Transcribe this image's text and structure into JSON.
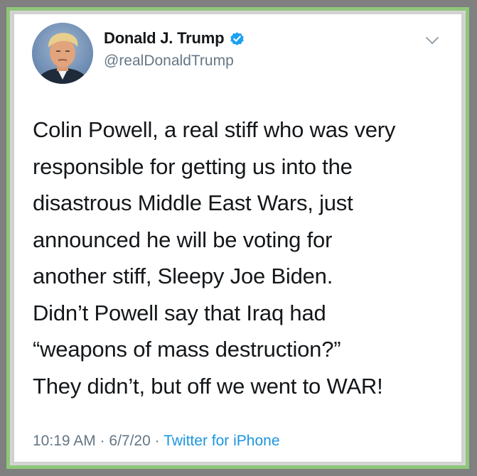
{
  "tweet": {
    "author": {
      "display_name": "Donald J. Trump",
      "handle": "@realDonaldTrump",
      "verified": true,
      "avatar_icon": "profile-photo"
    },
    "menu_icon": "chevron-down-icon",
    "text_lines": [
      "Colin Powell, a real stiff who was very",
      "responsible for getting us into the",
      "disastrous Middle East Wars, just",
      "announced he will be voting for",
      "another stiff, Sleepy Joe Biden.",
      "Didn’t Powell say that Iraq had",
      "“weapons of mass destruction?”",
      "They didn’t, but off we went to WAR!"
    ],
    "meta": {
      "time": "10:19 AM",
      "separator": " · ",
      "date": "6/7/20",
      "source": "Twitter for iPhone"
    }
  },
  "colors": {
    "frame_gray": "#808080",
    "frame_green": "#8fc77a",
    "verified_blue": "#1da1f2",
    "link_blue": "#1b95e0",
    "muted_text": "#657786",
    "main_text": "#14171a"
  }
}
